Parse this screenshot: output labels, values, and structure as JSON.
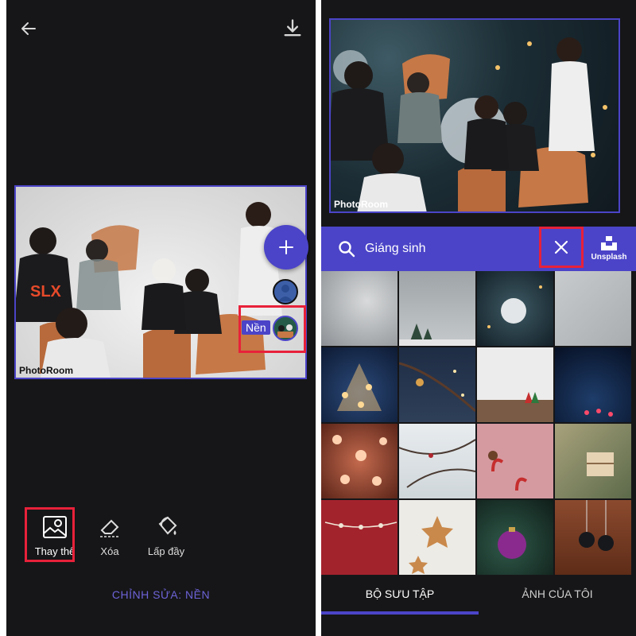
{
  "editor": {
    "watermark": "PhotoRoom",
    "layer_label": "Nền",
    "tools": [
      {
        "label": "Thay thế",
        "icon": "image-replace-icon"
      },
      {
        "label": "Xóa",
        "icon": "eraser-icon"
      },
      {
        "label": "Lấp đầy",
        "icon": "paint-bucket-icon"
      }
    ],
    "mode_label": "CHỈNH SỬA: NỀN",
    "shirt_text": "SLX"
  },
  "library": {
    "watermark": "PhotoRoom",
    "search": {
      "value": "Giáng sinh",
      "placeholder": ""
    },
    "unsplash_label": "Unsplash",
    "tabs": [
      {
        "label": "BỘ SƯU TẬP",
        "active": true
      },
      {
        "label": "ẢNH CỦA TÔI",
        "active": false
      }
    ],
    "tiles": [
      "snowy-gray-wall",
      "gray-wall-with-small-trees",
      "ornament-on-pine",
      "gray-snow-texture",
      "bokeh-christmas-tree",
      "bokeh-branch-ornament",
      "white-room-gnomes",
      "blue-bokeh-lights",
      "heart-bokeh",
      "snowy-branches",
      "pink-table-candy-canes",
      "gift-in-hands",
      "red-garland",
      "gingerbread-stars",
      "purple-ornament-tree",
      "hanging-ornaments-brown"
    ]
  },
  "colors": {
    "accent": "#4b44c8",
    "highlight": "#e8213a",
    "background": "#161618",
    "mode_text": "#6d63d8"
  }
}
